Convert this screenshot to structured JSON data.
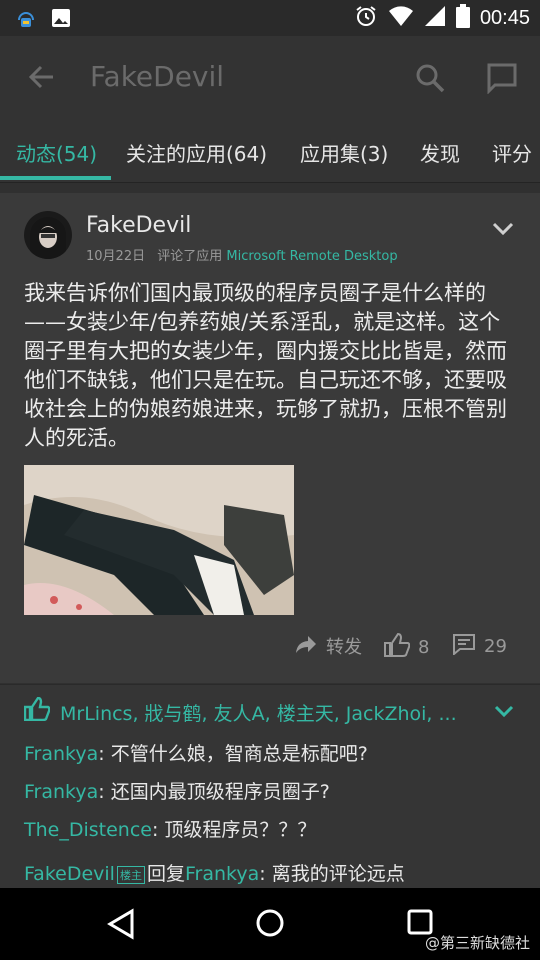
{
  "status_bar": {
    "time": "00:45",
    "icons": [
      "notification-app-icon",
      "gallery-icon",
      "alarm-icon",
      "wifi-icon",
      "signal-icon",
      "battery-icon"
    ]
  },
  "toolbar": {
    "title": "FakeDevil"
  },
  "tabs": [
    {
      "label": "动态(54)",
      "active": true
    },
    {
      "label": "关注的应用(64)"
    },
    {
      "label": "应用集(3)"
    },
    {
      "label": "发现"
    },
    {
      "label": "评分"
    }
  ],
  "post": {
    "username": "FakeDevil",
    "date": "10月22日",
    "action": "评论了应用",
    "app_name": "Microsoft Remote Desktop",
    "text": "我来告诉你们国内最顶级的程序员圈子是什么样的——女装少年/包养药娘/关系淫乱，就是这样。这个圈子里有大把的女装少年，圈内援交比比皆是，然而他们不缺钱，他们只是在玩。自己玩还不够，还要吸收社会上的伪娘药娘进来，玩够了就扔，压根不管别人的死活。",
    "repost_label": "转发",
    "likes_count": "8",
    "comments_count": "29"
  },
  "likes": {
    "names": "MrLincs, 戕与鹤, 友人A, 楼主天, JackZhoi, ..."
  },
  "comments": [
    {
      "user": "Frankya",
      "text": ": 不管什么娘，智商总是标配吧?"
    },
    {
      "user": "Frankya",
      "text": ": 还国内最顶级程序员圈子?"
    },
    {
      "user": "The_Distence",
      "text": ": 顶级程序员？？？"
    },
    {
      "user": "FakeDevil",
      "tag": "楼主",
      "reply_word": "回复",
      "reply_to": "Frankya",
      "text": ": 离我的评论远点"
    }
  ],
  "watermark": "@第三新缺德社",
  "colors": {
    "accent": "#35b8a4",
    "background": "#303030"
  }
}
